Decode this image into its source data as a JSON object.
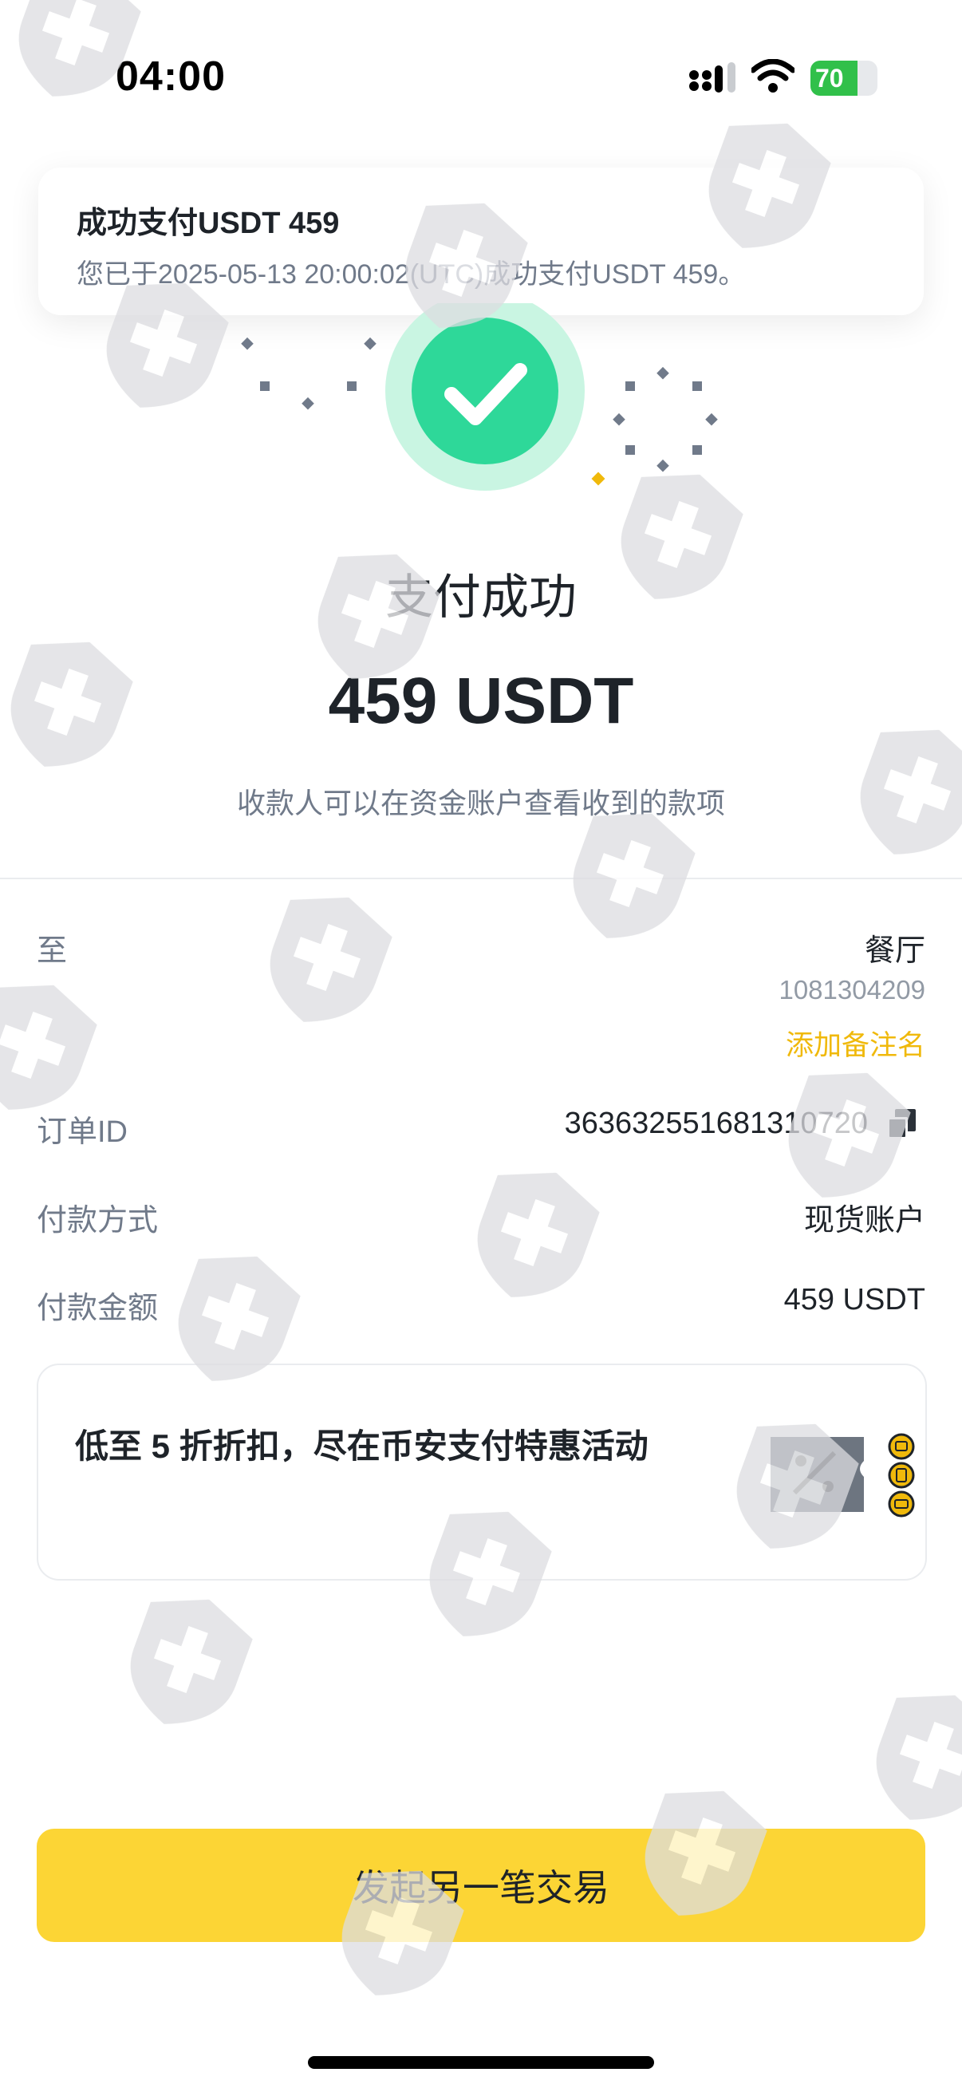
{
  "status_bar": {
    "time": "04:00",
    "battery": "70",
    "battery_level": 0.7,
    "icons": [
      "cellular-signal-icon",
      "wifi-icon",
      "battery-charging-icon"
    ]
  },
  "notification": {
    "title": "成功支付USDT 459",
    "message": "您已于2025-05-13 20:00:02(UTC)成功支付USDT 459。"
  },
  "result": {
    "icon": "check-circle-icon",
    "title": "支付成功",
    "amount": "459 USDT",
    "subtitle": "收款人可以在资金账户查看收到的款项"
  },
  "details": {
    "to_label": "至",
    "recipient_name": "餐厅",
    "recipient_id": "1081304209",
    "add_note": "添加备注名",
    "order_label": "订单ID",
    "order_id": "363632551681310720",
    "copy_icon": "copy-icon",
    "method_label": "付款方式",
    "method_value": "现货账户",
    "amount_label": "付款金额",
    "amount_value": "459 USDT"
  },
  "promo": {
    "text": "低至 5 折折扣，尽在币安支付特惠活动",
    "icon": "discount-coupon-icon"
  },
  "cta": {
    "label": "发起另一笔交易"
  },
  "colors": {
    "success": "#2ed899",
    "success_halo": "#c9f5e2",
    "brand": "#fcd535",
    "link": "#f0b90b",
    "watermark": "#e2e3e5"
  }
}
